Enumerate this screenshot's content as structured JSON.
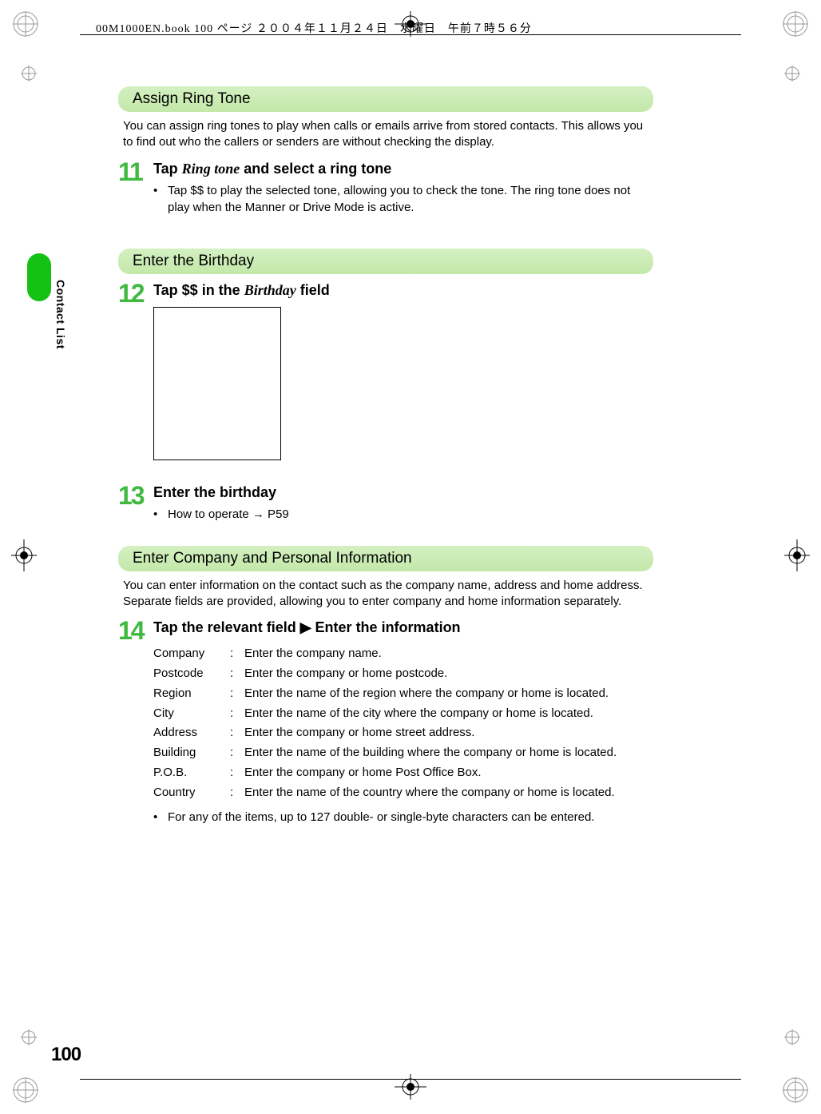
{
  "header_text": "00M1000EN.book  100 ページ  ２００４年１１月２４日　水曜日　午前７時５６分",
  "side_label": "Contact List",
  "page_number": "100",
  "sections": {
    "ringtone": {
      "title": "Assign Ring Tone",
      "intro": "You can assign ring tones to play when calls or emails arrive from stored contacts. This allows you to find out who the callers or senders are without checking the display.",
      "step11": {
        "num": "11",
        "title_pre": "Tap ",
        "title_em": "Ring tone",
        "title_post": " and select a ring tone",
        "bullet": "Tap $$ to play the selected tone, allowing you to check the tone. The ring tone does not play when the Manner or Drive Mode is active."
      }
    },
    "birthday": {
      "title": "Enter the Birthday",
      "step12": {
        "num": "12",
        "title_pre": "Tap $$ in the ",
        "title_em": "Birthday",
        "title_post": " field"
      },
      "step13": {
        "num": "13",
        "title": "Enter the birthday",
        "bullet": "How to operate → P59"
      }
    },
    "company": {
      "title": "Enter Company and Personal Information",
      "intro": "You can enter information on the contact such as the company name, address and home address. Separate fields are provided, allowing you to enter company and home information separately.",
      "step14": {
        "num": "14",
        "title": "Tap the relevant field ▶ Enter the information",
        "fields": [
          {
            "label": "Company",
            "desc": "Enter the company name."
          },
          {
            "label": "Postcode",
            "desc": "Enter the company or home postcode."
          },
          {
            "label": "Region",
            "desc": "Enter the name of the region where the company or home is located."
          },
          {
            "label": "City",
            "desc": "Enter the name of the city where the company or home is located."
          },
          {
            "label": "Address",
            "desc": "Enter the company or home street address."
          },
          {
            "label": "Building",
            "desc": "Enter the name of the building where the company or home is located."
          },
          {
            "label": "P.O.B.",
            "desc": "Enter the company or home Post Office Box."
          },
          {
            "label": "Country",
            "desc": "Enter the name of the country where the company or home is located."
          }
        ],
        "note": "For any of the items, up to 127 double- or single-byte characters can be entered."
      }
    }
  }
}
